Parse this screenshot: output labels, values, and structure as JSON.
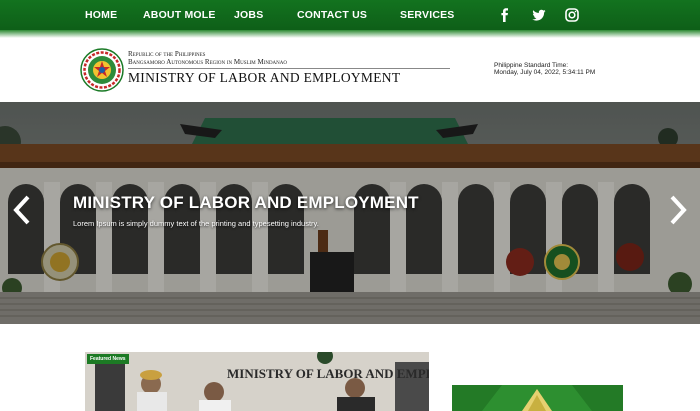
{
  "nav": {
    "items": [
      "HOME",
      "ABOUT MOLE",
      "JOBS",
      "CONTACT US",
      "SERVICES"
    ],
    "social": [
      "facebook-icon",
      "twitter-icon",
      "instagram-icon"
    ],
    "bg_color": "#13731f"
  },
  "header": {
    "org_line1": "Republic of the Philippines",
    "org_line2": "Bangsamoro Autonomous Region in Muslim Mindanao",
    "ministry": "MINISTRY OF LABOR AND EMPLOYMENT",
    "pst_label": "Philippine Standard Time:",
    "pst_time": "Monday, July 04, 2022, 5:34:11 PM"
  },
  "hero": {
    "title": "MINISTRY OF LABOR AND EMPLOYMENT",
    "subtitle": "Lorem Ipsum is simply dummy text of the printing and typesetting industry."
  },
  "content": {
    "featured_badge": "Featured News",
    "featured_caption": "MINISTRY OF LABOR AND EMPLOY"
  }
}
